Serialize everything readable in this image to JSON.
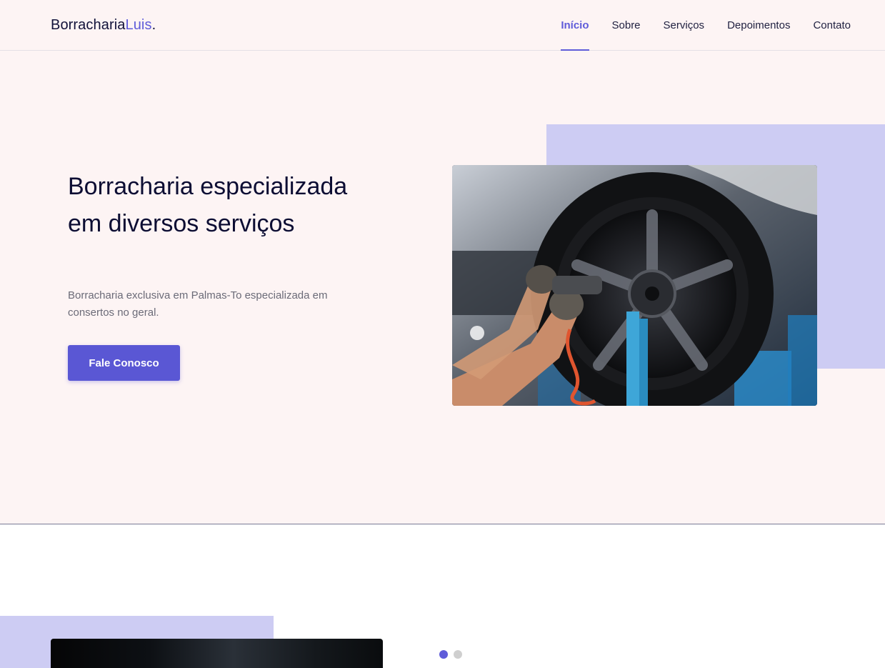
{
  "header": {
    "logo": {
      "main": "Borracharia",
      "accent": "Luis",
      "dot": "."
    },
    "nav": [
      {
        "label": "Início",
        "active": true
      },
      {
        "label": "Sobre",
        "active": false
      },
      {
        "label": "Serviços",
        "active": false
      },
      {
        "label": "Depoimentos",
        "active": false
      },
      {
        "label": "Contato",
        "active": false
      }
    ]
  },
  "hero": {
    "title": "Borracharia especializada em diversos serviços",
    "subtitle": "Borracharia exclusiva em Palmas-To especializada em consertos no geral.",
    "cta_label": "Fale Conosco",
    "image_icon": "tire-service-photo"
  },
  "section2": {
    "carousel": {
      "total": 2,
      "active_index": 0
    }
  },
  "colors": {
    "accent": "#5f5cd9",
    "button": "#5a57d4",
    "hero_bg": "#fdf4f4",
    "deco": "#cdccf3",
    "heading": "#0c0d33"
  }
}
